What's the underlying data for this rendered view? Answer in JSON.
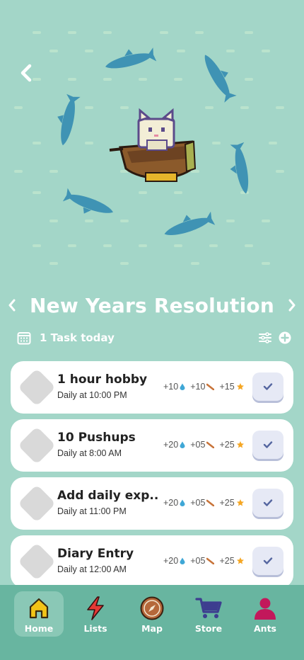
{
  "list": {
    "title": "New Years Resolution"
  },
  "summary": {
    "task_count_label": "1 Task today"
  },
  "tasks": [
    {
      "name": "1 hour hobby",
      "schedule": "Daily at 10:00 PM",
      "water": "+10",
      "wood": "+10",
      "stars": "+15"
    },
    {
      "name": "10 Pushups",
      "schedule": "Daily at 8:00 AM",
      "water": "+20",
      "wood": "+05",
      "stars": "+25"
    },
    {
      "name": "Add daily exp..",
      "schedule": "Daily at 11:00 PM",
      "water": "+20",
      "wood": "+05",
      "stars": "+25"
    },
    {
      "name": "Diary Entry",
      "schedule": "Daily at 12:00 AM",
      "water": "+20",
      "wood": "+05",
      "stars": "+25"
    }
  ],
  "nav": {
    "home": "Home",
    "lists": "Lists",
    "map": "Map",
    "store": "Store",
    "ants": "Ants"
  },
  "colors": {
    "background": "#a3d6c8",
    "nav_background": "#68b5a0",
    "shark": "#3f93b4",
    "home_icon": "#f2c418",
    "lists_icon": "#e53935",
    "map_icon": "#b5683a",
    "store_icon": "#3d3d8f",
    "ants_icon": "#c2185b"
  }
}
